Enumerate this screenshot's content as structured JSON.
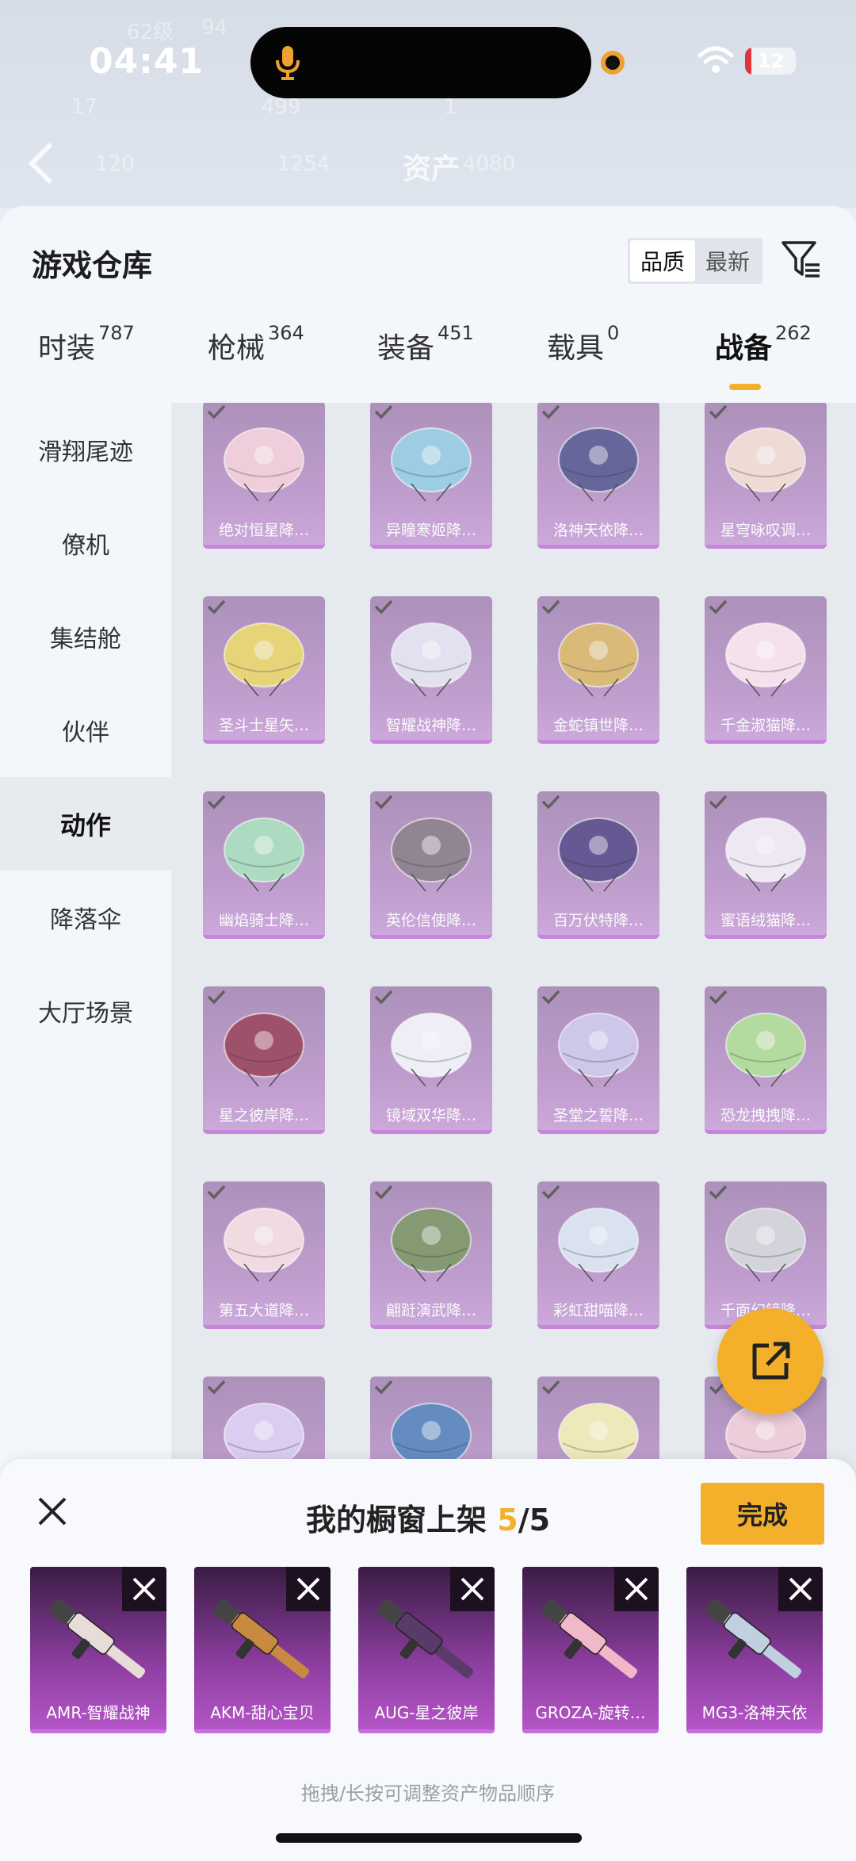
{
  "status_bar": {
    "time": "04:41",
    "battery": "12",
    "battery_level": 0.12
  },
  "background_header": {
    "level": "62级",
    "coins": "94",
    "stat1": "17",
    "stat2": "499",
    "stat3": "1",
    "stat4": "120",
    "stat5": "1254",
    "title": "资产",
    "stat6": "4080"
  },
  "header": {
    "title": "游戏仓库",
    "sort_options": [
      "品质",
      "最新"
    ],
    "sort_active": "品质"
  },
  "tabs": [
    {
      "label": "时装",
      "count": "787"
    },
    {
      "label": "枪械",
      "count": "364"
    },
    {
      "label": "装备",
      "count": "451"
    },
    {
      "label": "载具",
      "count": "0"
    },
    {
      "label": "战备",
      "count": "262"
    }
  ],
  "active_tab": "战备",
  "sidebar": {
    "items": [
      "滑翔尾迹",
      "僚机",
      "集结舱",
      "伙伴",
      "动作",
      "降落伞",
      "大厅场景"
    ],
    "active": "动作"
  },
  "items": [
    {
      "label": "绝对恒星降…",
      "color": "#f2c8d8"
    },
    {
      "label": "异瞳寒姬降…",
      "color": "#8ec8e0"
    },
    {
      "label": "洛神天依降…",
      "color": "#4a4a8a"
    },
    {
      "label": "星穹咏叹调…",
      "color": "#f0d8d0"
    },
    {
      "label": "圣斗士星矢…",
      "color": "#e8d060"
    },
    {
      "label": "智耀战神降…",
      "color": "#e0e0f0"
    },
    {
      "label": "金蛇镇世降…",
      "color": "#d8b060"
    },
    {
      "label": "千金淑猫降…",
      "color": "#f8e0ec"
    },
    {
      "label": "幽焰骑士降…",
      "color": "#a0d8b8"
    },
    {
      "label": "英伦信使降…",
      "color": "#807080"
    },
    {
      "label": "百万伏特降…",
      "color": "#4a3a80"
    },
    {
      "label": "蜜语绒猫降…",
      "color": "#f0e8f4"
    },
    {
      "label": "星之彼岸降…",
      "color": "#903050"
    },
    {
      "label": "镜域双华降…",
      "color": "#f0f0f8"
    },
    {
      "label": "圣堂之誓降…",
      "color": "#c8c0e8"
    },
    {
      "label": "恐龙拽拽降…",
      "color": "#a8d890"
    },
    {
      "label": "第五大道降…",
      "color": "#f4d8e0"
    },
    {
      "label": "翩跹演武降…",
      "color": "#708858"
    },
    {
      "label": "彩虹甜喵降…",
      "color": "#d8e0f0"
    },
    {
      "label": "千面幻镜降…",
      "color": "#d0d0d8"
    },
    {
      "label": "",
      "color": "#d8c8f0"
    },
    {
      "label": "",
      "color": "#4878b8"
    },
    {
      "label": "",
      "color": "#f0e8b0"
    },
    {
      "label": "",
      "color": "#f0c8d8"
    }
  ],
  "bottom_sheet": {
    "title": "我的橱窗上架",
    "count": "5",
    "total": "/5",
    "done_label": "完成",
    "slots": [
      {
        "label": "AMR-智耀战神",
        "color": "#e8dcd8"
      },
      {
        "label": "AKM-甜心宝贝",
        "color": "#c88a40"
      },
      {
        "label": "AUG-星之彼岸",
        "color": "#5a3a6a"
      },
      {
        "label": "GROZA-旋转…",
        "color": "#f0b8c8"
      },
      {
        "label": "MG3-洛神天依",
        "color": "#c0d0e0"
      }
    ],
    "hint": "拖拽/长按可调整资产物品顺序"
  },
  "colors": {
    "accent": "#f4b02a",
    "card": "#b88ec8",
    "slot": "#8d3ea0"
  }
}
